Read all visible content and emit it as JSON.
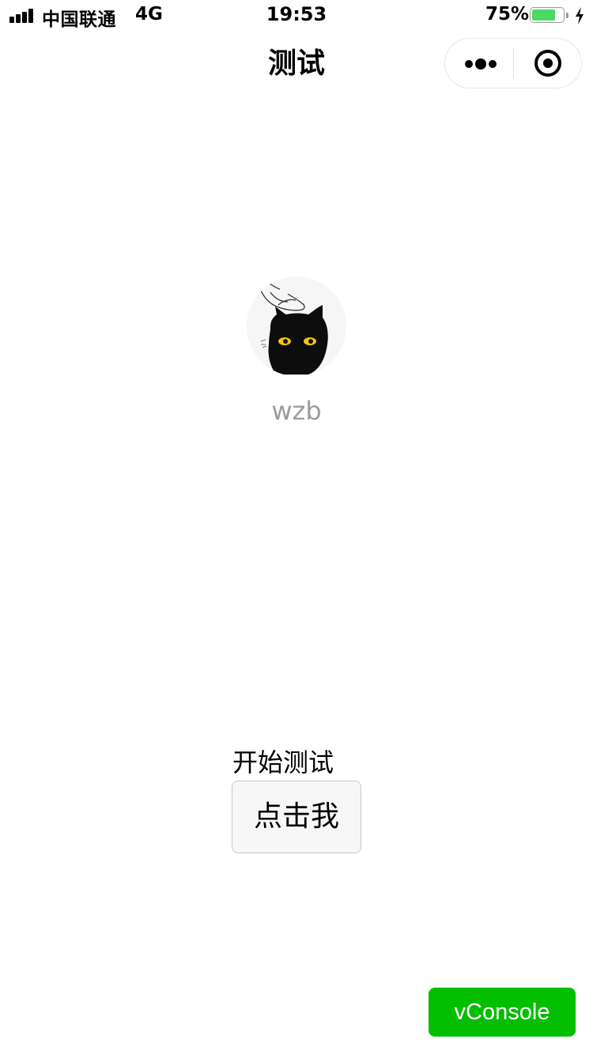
{
  "status_bar": {
    "carrier": "中国联通",
    "network": "4G",
    "time": "19:53",
    "battery_percent": "75%",
    "battery_level": 0.75,
    "signal_bars": 4,
    "charging": true
  },
  "nav": {
    "title": "测试",
    "more_icon": "more-dots-icon",
    "close_icon": "target-close-icon"
  },
  "profile": {
    "avatar": "cat-avatar",
    "username": "wzb"
  },
  "test": {
    "label": "开始测试",
    "button_label": "点击我"
  },
  "vconsole": {
    "label": "vConsole",
    "color": "#04be02"
  },
  "colors": {
    "battery": "#4cd964",
    "username": "#9b9b9b"
  }
}
